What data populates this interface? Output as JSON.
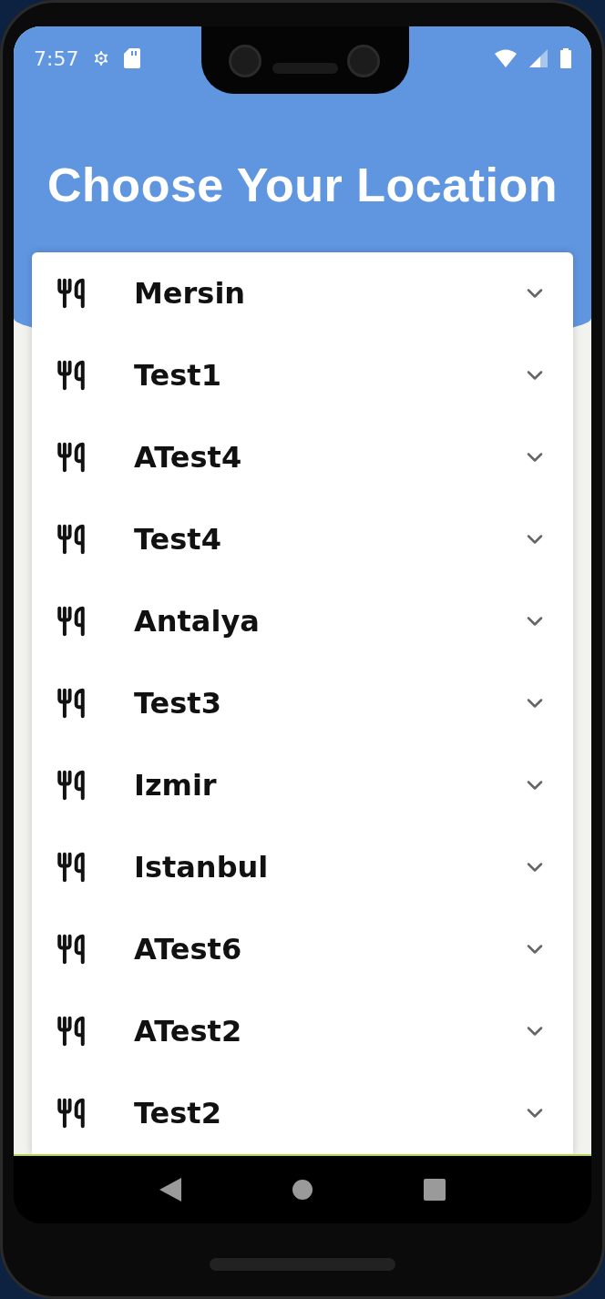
{
  "status_bar": {
    "time": "7:57"
  },
  "title": "Choose Your Location",
  "locations": [
    {
      "name": "Mersin"
    },
    {
      "name": "Test1"
    },
    {
      "name": "ATest4"
    },
    {
      "name": "Test4"
    },
    {
      "name": "Antalya"
    },
    {
      "name": "Test3"
    },
    {
      "name": "Izmir"
    },
    {
      "name": "Istanbul"
    },
    {
      "name": "ATest6"
    },
    {
      "name": "ATest2"
    },
    {
      "name": "Test2"
    }
  ]
}
